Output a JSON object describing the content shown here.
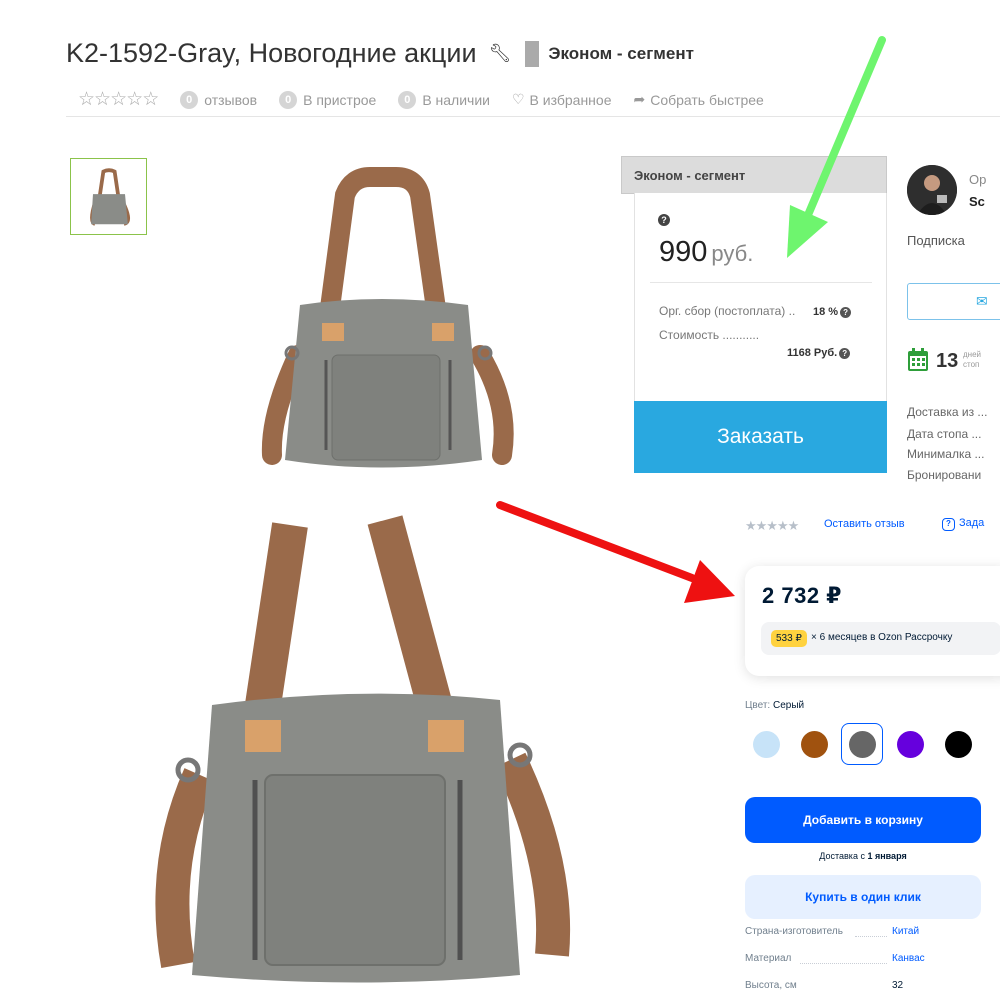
{
  "product": {
    "title": "K2-1592-Gray, Новогодние акции",
    "segment": "Эконом - сегмент"
  },
  "meta": {
    "reviews_count": "0",
    "reviews_label": "отзывов",
    "attach_count": "0",
    "attach_label": "В пристрое",
    "stock_count": "0",
    "stock_label": "В наличии",
    "favorite_label": "В избранное",
    "fast_label": "Собрать быстрее"
  },
  "price_box": {
    "segment_header": "Эконом - сегмент",
    "price": "990",
    "currency": "руб.",
    "fee_label": "Орг. сбор (постоплата) ..",
    "fee_value": "18 %",
    "cost_label": "Стоимость ...........",
    "cost_value": "1168 Руб.",
    "order_button": "Заказать"
  },
  "organizer": {
    "label": "Ор",
    "name": "Sc",
    "subscribe": "Подписка",
    "days": "13",
    "days_label_1": "дней",
    "days_label_2": "стоп",
    "info": [
      "Доставка из ...",
      "Дата стопа ...",
      "Минималка ...",
      "Бронировани"
    ]
  },
  "ozon": {
    "review_link": "Оставить отзыв",
    "ask_link": "Зада",
    "price": "2 732 ₽",
    "installment_badge": "533 ₽",
    "installment_text": "× 6 месяцев в Ozon Рассрочку",
    "color_label": "Цвет:",
    "color_value": "Серый",
    "swatches": [
      "#c7e3f8",
      "#a0520f",
      "#666666",
      "#6600dd",
      "#000000"
    ],
    "cart_button": "Добавить в корзину",
    "delivery_prefix": "Доставка с ",
    "delivery_date": "1 января",
    "one_click_button": "Купить в один клик",
    "specs": [
      {
        "label": "Страна-изготовитель",
        "value": "Китай"
      },
      {
        "label": "Материал",
        "value": "Канвас"
      },
      {
        "label": "Высота, см",
        "value": "32"
      }
    ]
  },
  "colors": {
    "order_blue": "#29a8e0",
    "ozon_blue": "#005bff",
    "thumb_border": "#8bc34a",
    "arrow_green": "#6ef56e",
    "arrow_red": "#ee1111",
    "bag_gray": "#8a8c88",
    "strap_brown": "#9a6a4a"
  }
}
